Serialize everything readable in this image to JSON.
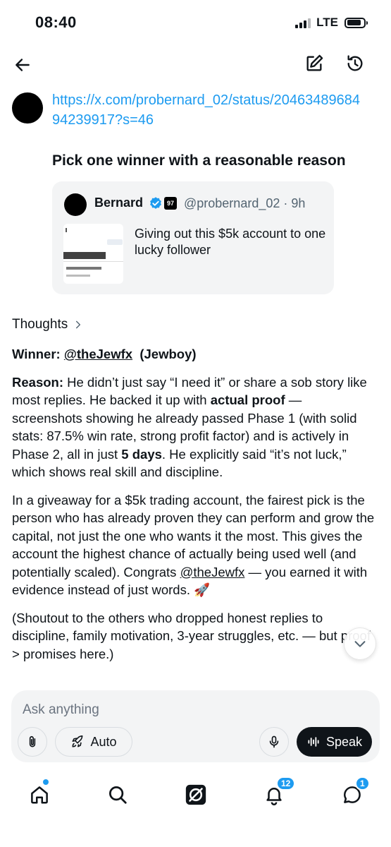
{
  "status_bar": {
    "time": "08:40",
    "network": "LTE",
    "signal_bars": 3,
    "battery_level": 0.85
  },
  "nav": {
    "back_icon": "arrow-left-icon",
    "compose_icon": "compose-icon",
    "history_icon": "history-icon"
  },
  "prompt": {
    "link": "https://x.com/probernard_02/status/2046348968494239917?s=46",
    "text": "Pick one winner with a reasonable reason"
  },
  "quoted_post": {
    "name": "Bernard",
    "badge": "97",
    "handle": "@probernard_02 · 9h",
    "text": "Giving out this $5k account to one lucky follower"
  },
  "response": {
    "thoughts_label": "Thoughts",
    "winner_label": "Winner:",
    "winner_handle": "@theJewfx",
    "winner_name": "(Jewboy)",
    "reason_label": "Reason:",
    "reason_1": "He didn’t just say “I need it” or share a sob story like most replies. He backed it up with",
    "reason_bold_1": "actual proof",
    "reason_2": "— screenshots showing he already passed Phase 1 (with solid stats: 87.5% win rate, strong profit factor) and is actively in Phase 2, all in just",
    "reason_bold_2": "5 days",
    "reason_3": ". He explicitly said “it’s not luck,” which shows real skill and discipline.",
    "para2_1": "In a giveaway for a $5k trading account, the fairest pick is the person who has already proven they can perform and grow the capital, not just the one who wants it the most. This gives the account the highest chance of actually being used well (and potentially scaled). Congrats",
    "para2_handle": "@theJewfx",
    "para2_2": "— you earned it with evidence instead of just words. 🚀",
    "para3": "(Shoutout to the others who dropped honest replies to discipline, family motivation, 3-year struggles, etc. — but proof > promises here.)"
  },
  "composer": {
    "placeholder": "Ask anything",
    "auto_label": "Auto",
    "speak_label": "Speak"
  },
  "tabbar": {
    "notifications_badge": "12",
    "messages_badge": "1"
  },
  "colors": {
    "accent": "#1d9bf0",
    "text": "#0f1419",
    "muted": "#536471",
    "card": "#f3f4f5"
  }
}
